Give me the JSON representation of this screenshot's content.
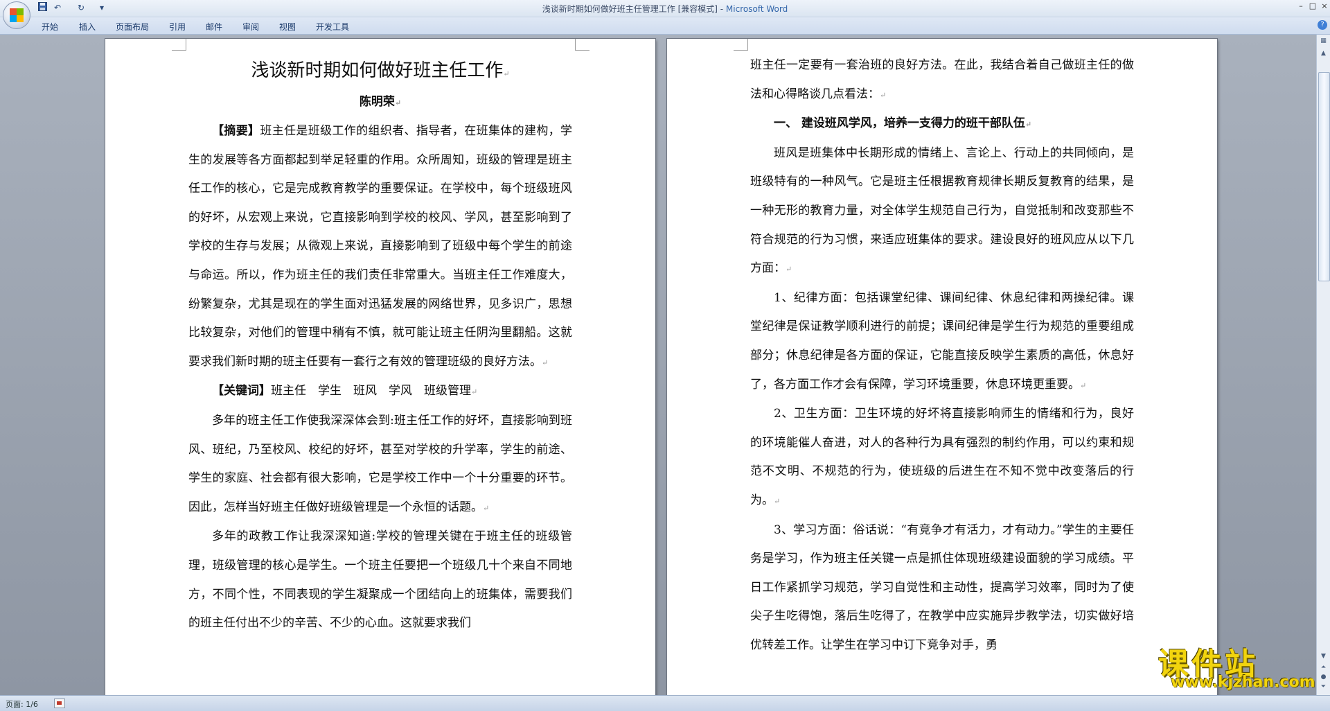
{
  "window": {
    "title_doc": "浅谈新时期如何做好班主任管理工作 [兼容模式] - ",
    "title_app": "Microsoft Word",
    "minimize": "–",
    "maximize": "□",
    "close": "×"
  },
  "quick_access": {
    "save_icon": "floppy-icon",
    "undo": "↶",
    "redo": "↻",
    "dropdown": "▾"
  },
  "ribbon_tabs": [
    "开始",
    "插入",
    "页面布局",
    "引用",
    "邮件",
    "审阅",
    "视图",
    "开发工具"
  ],
  "help": "?",
  "page1": {
    "title": "浅谈新时期如何做好班主任工作",
    "author": "陈明荣",
    "abstract_label": "【摘要】",
    "abstract_text": "班主任是班级工作的组织者、指导者，在班集体的建构，学生的发展等各方面都起到举足轻重的作用。众所周知，班级的管理是班主任工作的核心，它是完成教育教学的重要保证。在学校中，每个班级班风的好坏，从宏观上来说，它直接影响到学校的校风、学风，甚至影响到了学校的生存与发展；从微观上来说，直接影响到了班级中每个学生的前途与命运。所以，作为班主任的我们责任非常重大。当班主任工作难度大，纷繁复杂，尤其是现在的学生面对迅猛发展的网络世界，见多识广，思想比较复杂，对他们的管理中稍有不慎，就可能让班主任阴沟里翻船。这就要求我们新时期的班主任要有一套行之有效的管理班级的良好方法。",
    "keywords_label": "【关键词】",
    "keywords_text": "班主任　学生　班风　学风　班级管理",
    "para1": "多年的班主任工作使我深深体会到:班主任工作的好坏，直接影响到班风、班纪，乃至校风、校纪的好坏，甚至对学校的升学率，学生的前途、学生的家庭、社会都有很大影响，它是学校工作中一个十分重要的环节。因此，怎样当好班主任做好班级管理是一个永恒的话题。",
    "para2": "多年的政教工作让我深深知道:学校的管理关键在于班主任的班级管理，班级管理的核心是学生。一个班主任要把一个班级几十个来自不同地方，不同个性，不同表现的学生凝聚成一个团结向上的班集体，需要我们的班主任付出不少的辛苦、不少的心血。这就要求我们"
  },
  "page2": {
    "para0": "班主任一定要有一套治班的良好方法。在此，我结合着自己做班主任的做法和心得略谈几点看法：",
    "heading1": "一、 建设班风学风，培养一支得力的班干部队伍",
    "para1": "班风是班集体中长期形成的情绪上、言论上、行动上的共同倾向，是班级特有的一种风气。它是班主任根据教育规律长期反复教育的结果，是一种无形的教育力量，对全体学生规范自己行为，自觉抵制和改变那些不符合规范的行为习惯，来适应班集体的要求。建设良好的班风应从以下几方面：",
    "para2": "1、纪律方面：包括课堂纪律、课间纪律、休息纪律和两操纪律。课堂纪律是保证教学顺利进行的前提；课间纪律是学生行为规范的重要组成部分；休息纪律是各方面的保证，它能直接反映学生素质的高低，休息好了，各方面工作才会有保障，学习环境重要，休息环境更重要。",
    "para3": "2、卫生方面：卫生环境的好坏将直接影响师生的情绪和行为，良好的环境能催人奋进，对人的各种行为具有强烈的制约作用，可以约束和规范不文明、不规范的行为，使班级的后进生在不知不觉中改变落后的行为。",
    "para4": "3、学习方面：俗话说：“有竞争才有活力，才有动力。”学生的主要任务是学习，作为班主任关键一点是抓住体现班级建设面貌的学习成绩。平日工作紧抓学习规范，学习自觉性和主动性，提高学习效率，同时为了使尖子生吃得饱，落后生吃得了，在教学中应实施异步教学法，切实做好培优转差工作。让学生在学习中订下竞争对手，勇"
  },
  "paragraph_mark": "↵",
  "status": {
    "page": "页面: 1/6"
  },
  "watermark": {
    "text": "课件站",
    "url": "www.kjzhan.com"
  }
}
